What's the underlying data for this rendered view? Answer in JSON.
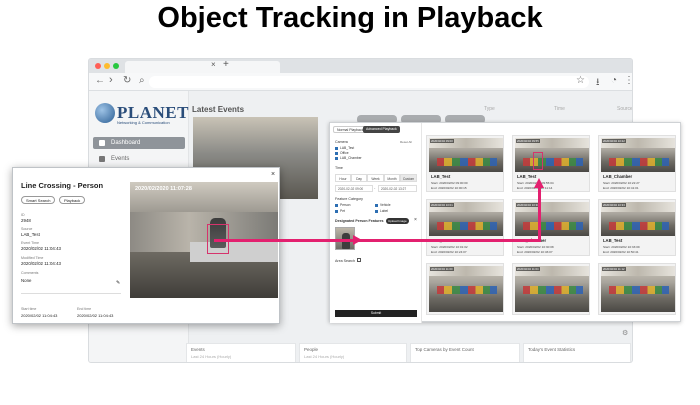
{
  "page_title": "Object Tracking in Playback",
  "browser": {
    "nav_back": "←",
    "nav_forward": "›",
    "nav_reload": "↻",
    "tab_close": "×",
    "tab_new": "+",
    "url_icon": "⌕",
    "star": "☆",
    "download": "⭳",
    "profile": "◔",
    "menu": "⋮"
  },
  "logo": {
    "name": "PLANET",
    "tagline": "Networking & Communication"
  },
  "sidebar": {
    "items": [
      {
        "label": "Dashboard",
        "icon": "home-icon"
      },
      {
        "label": "Events",
        "icon": "events-icon"
      }
    ]
  },
  "main": {
    "title": "Latest Events",
    "columns": [
      "Type",
      "Time",
      "Source"
    ],
    "bottom_cards": [
      {
        "title": "Events",
        "sub": "Last 24 Hours (Hourly)"
      },
      {
        "title": "People",
        "sub": "Last 24 Hours (Hourly)"
      },
      {
        "title": "Top Cameras by Event Count",
        "sub": ""
      },
      {
        "title": "Today's Event Statistics",
        "sub": ""
      }
    ]
  },
  "playback": {
    "tabs": [
      "Normal Playback",
      "Advanced Playback"
    ],
    "camera_label": "Camera",
    "reset_all": "Reset All",
    "cameras": [
      "LAB_Test",
      "Office",
      "LAB_Chamber"
    ],
    "time_label": "Time",
    "time_segments": [
      "Hour",
      "Day",
      "Week",
      "Month",
      "Custom"
    ],
    "date_start": "2020-02-02 09:00",
    "date_end": "2020-02-02 13:27",
    "feature_label": "Feature Category",
    "features": [
      "Person",
      "Vehicle",
      "Pet",
      "Label"
    ],
    "designated_label": "Designated Person Features",
    "upload_button": "Upload Image",
    "area_label": "Area Search",
    "submit": "Submit"
  },
  "results": [
    {
      "tag": "2020/02/02 09:00",
      "name": "LAB_Test",
      "start": "Start: 2020/02/02 09:00:00",
      "end": "End: 2020/02/02 10:00:15"
    },
    {
      "tag": "2020/02/02 09:55",
      "name": "LAB_Test",
      "start": "Start: 2020/02/02 09:55:04",
      "end": "End: 2020/02/02 10:11:14"
    },
    {
      "tag": "2020/02/02 10:22",
      "name": "LAB_Chamber",
      "start": "Start: 2020/02/02 10:22:27",
      "end": "End: 2020/02/02 10:41:01"
    },
    {
      "tag": "2020/02/02 10:01",
      "name": "LAB_Test",
      "start": "Start: 2020/02/02 10:01:02",
      "end": "End: 2020/02/02 10:24:07"
    },
    {
      "tag": "2020/02/02 10:30",
      "name": "LAB_Chamber",
      "start": "Start: 2020/02/02 10:30:08",
      "end": "End: 2020/02/02 10:46:07"
    },
    {
      "tag": "2020/02/02 10:33",
      "name": "LAB_Test",
      "start": "Start: 2020/02/02 10:33:09",
      "end": "End: 2020/02/02 10:50:41"
    },
    {
      "tag": "2020/02/02 11:00",
      "name": "",
      "start": "",
      "end": ""
    },
    {
      "tag": "2020/02/02 11:04",
      "name": "",
      "start": "",
      "end": ""
    },
    {
      "tag": "2020/02/02 11:12",
      "name": "",
      "start": "",
      "end": ""
    }
  ],
  "popup": {
    "title": "Line Crossing - Person",
    "close": "×",
    "buttons": [
      "Smart Search",
      "Playback"
    ],
    "fields": [
      {
        "label": "ID",
        "value": "2948"
      },
      {
        "label": "Source",
        "value": "LAB_Test"
      },
      {
        "label": "Event Time",
        "value": "2020/02/02 11:04:43"
      },
      {
        "label": "Modified Time",
        "value": "2020/02/02 11:04:43"
      },
      {
        "label": "Comments",
        "value": "None"
      }
    ],
    "edit_icon": "✎",
    "start_time_label": "Start time",
    "start_time": "2020/02/02 11:04:43",
    "end_time_label": "End time",
    "end_time": "2020/02/02 11:04:43",
    "video_timestamp": "2020/02/2020 11:07:28"
  },
  "settings_icon": "⚙",
  "colors": {
    "accent": "#e3206f",
    "sidebar_active": "#8f949a",
    "checkbox": "#2d6fb3"
  }
}
